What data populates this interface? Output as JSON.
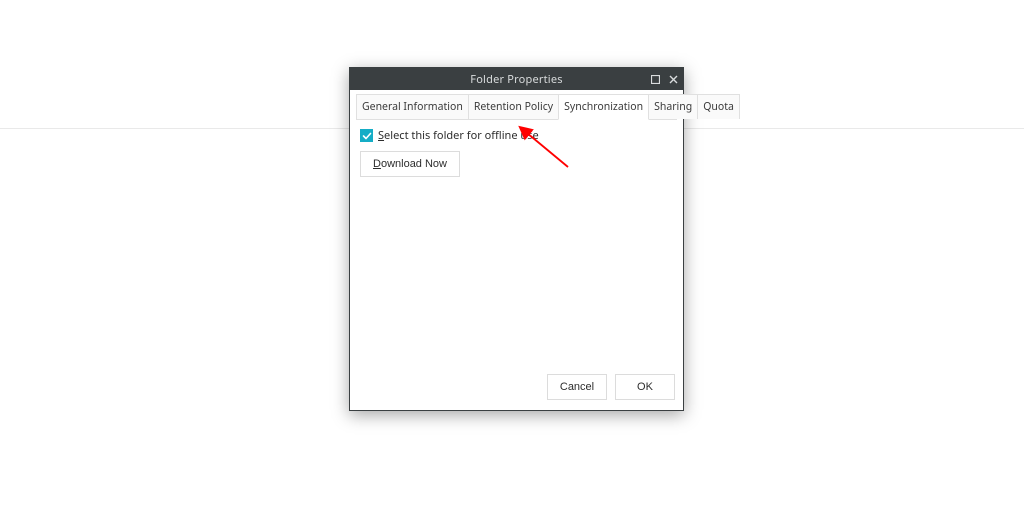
{
  "dialog": {
    "title": "Folder Properties",
    "tabs": [
      {
        "label": "General Information"
      },
      {
        "label": "Retention Policy"
      },
      {
        "label": "Synchronization"
      },
      {
        "label": "Sharing"
      },
      {
        "label": "Quota"
      }
    ],
    "active_tab_index": 2,
    "sync": {
      "checkbox_checked": true,
      "checkbox_label_mnemonic": "S",
      "checkbox_label_rest": "elect this folder for offline use",
      "download_mnemonic": "D",
      "download_rest": "ownload Now"
    },
    "footer": {
      "cancel": "Cancel",
      "ok": "OK"
    }
  },
  "annotation": {
    "arrow_color": "#ff0000"
  }
}
